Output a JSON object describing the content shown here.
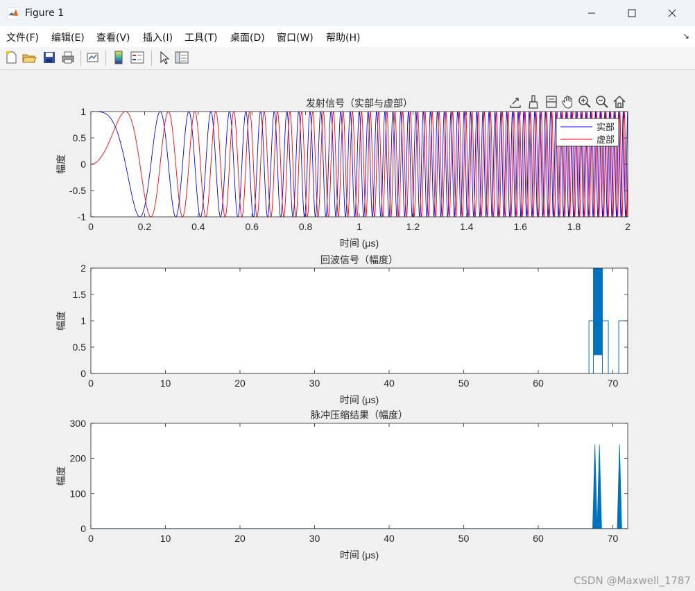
{
  "window": {
    "title": "Figure 1",
    "minimize_icon": "minimize-icon",
    "maximize_icon": "maximize-icon",
    "close_icon": "close-icon"
  },
  "menu": [
    "文件(F)",
    "编辑(E)",
    "查看(V)",
    "插入(I)",
    "工具(T)",
    "桌面(D)",
    "窗口(W)",
    "帮助(H)"
  ],
  "menu_dock_icon": "dock-arrow-icon",
  "toolbar": [
    "new-figure-icon",
    "open-file-icon",
    "save-icon",
    "print-icon",
    "link-plot-icon",
    "insert-colorbar-icon",
    "insert-legend-icon",
    "edit-plot-icon",
    "property-inspector-icon"
  ],
  "axes_toolbar": [
    "export-icon",
    "brush-icon",
    "datatip-icon",
    "pan-icon",
    "zoom-in-icon",
    "zoom-out-icon",
    "home-icon"
  ],
  "watermark": "CSDN @Maxwell_1787",
  "chart_data": [
    {
      "type": "line",
      "title": "发射信号（实部与虚部）",
      "xlabel": "时间 (μs)",
      "ylabel": "幅度",
      "xlim": [
        0,
        2
      ],
      "ylim": [
        -1,
        1
      ],
      "xticks": [
        "0",
        "0.2",
        "0.4",
        "0.6",
        "0.8",
        "1",
        "1.2",
        "1.4",
        "1.6",
        "1.8",
        "2"
      ],
      "yticks": [
        "-1",
        "-0.5",
        "0",
        "0.5",
        "1"
      ],
      "legend": {
        "placement": "top-right"
      },
      "series": [
        {
          "name": "实部",
          "color": "#0000ff",
          "kind": "cos",
          "amplitude": 1
        },
        {
          "name": "虚部",
          "color": "#ff0000",
          "kind": "sin",
          "amplitude": 1
        }
      ],
      "description_params": {
        "chirp_cycles": 60
      },
      "grid": false
    },
    {
      "type": "line",
      "title": "回波信号（幅度）",
      "xlabel": "时间 (μs)",
      "ylabel": "幅度",
      "xlim": [
        0,
        72
      ],
      "ylim": [
        0,
        2
      ],
      "xticks": [
        "0",
        "10",
        "20",
        "30",
        "40",
        "50",
        "60",
        "70"
      ],
      "yticks": [
        "0",
        "0.5",
        "1",
        "1.5",
        "2"
      ],
      "series": [
        {
          "color": "#0072bd",
          "segments": [
            {
              "start": 66.8,
              "end": 67.4,
              "level": 1
            },
            {
              "start": 67.4,
              "end": 68.6,
              "level": 2,
              "burst": true
            },
            {
              "start": 68.6,
              "end": 69.4,
              "level": 1
            },
            {
              "start": 70.8,
              "end": 72,
              "level": 1
            }
          ]
        }
      ],
      "grid": false
    },
    {
      "type": "line",
      "title": "脉冲压缩结果（幅度）",
      "xlabel": "时间 (μs)",
      "ylabel": "幅度",
      "xlim": [
        0,
        72
      ],
      "ylim": [
        0,
        300
      ],
      "xticks": [
        "0",
        "10",
        "20",
        "30",
        "40",
        "50",
        "60",
        "70"
      ],
      "yticks": [
        "0",
        "100",
        "200",
        "300"
      ],
      "series": [
        {
          "color": "#0072bd",
          "peaks": [
            {
              "x": 67.6,
              "y": 240
            },
            {
              "x": 68.2,
              "y": 240
            },
            {
              "x": 70.9,
              "y": 240
            }
          ]
        }
      ],
      "grid": false
    }
  ]
}
